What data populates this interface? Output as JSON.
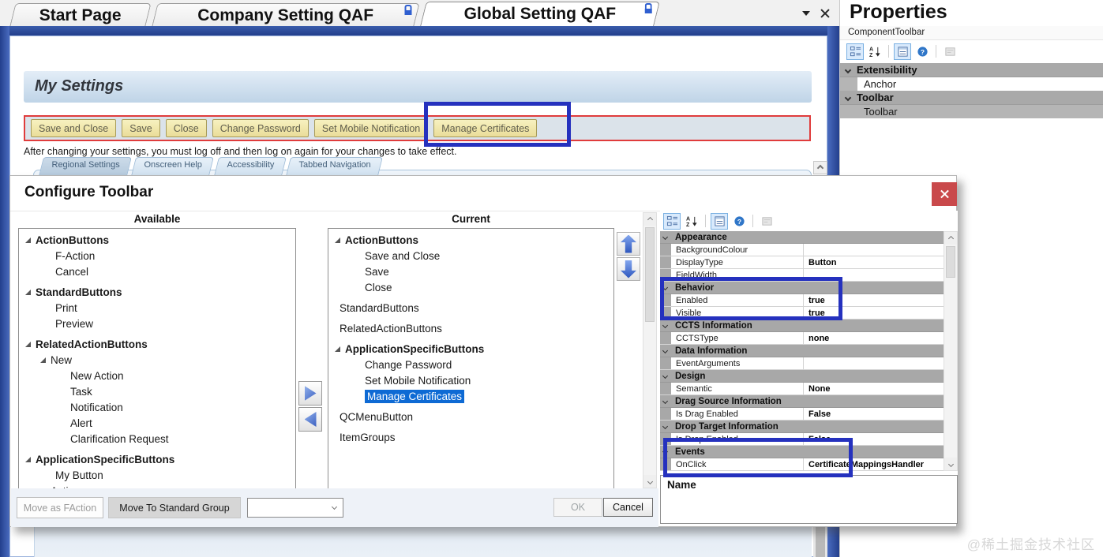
{
  "tabs": {
    "items": [
      {
        "label": "Start Page",
        "locked": false,
        "active": false
      },
      {
        "label": "Company Setting QAF",
        "locked": true,
        "active": false
      },
      {
        "label": "Global Setting QAF",
        "locked": true,
        "active": true
      }
    ]
  },
  "page": {
    "title": "My Settings",
    "toolbar_buttons": [
      "Save and Close",
      "Save",
      "Close",
      "Change Password",
      "Set Mobile Notification",
      "Manage Certificates"
    ],
    "info_text": "After changing your settings, you must log off and then log on again for your changes to take effect.",
    "sub_tabs": [
      "Regional Settings",
      "Onscreen Help",
      "Accessibility",
      "Tabbed Navigation"
    ]
  },
  "properties_panel": {
    "title": "Properties",
    "object": "ComponentToolbar",
    "rows": [
      {
        "type": "header",
        "label": "Extensibility"
      },
      {
        "type": "item",
        "label": "Anchor"
      },
      {
        "type": "header",
        "label": "Toolbar"
      },
      {
        "type": "item",
        "label": "Toolbar",
        "gray": true
      }
    ]
  },
  "dialog": {
    "title": "Configure Toolbar",
    "available": {
      "header": "Available",
      "items": [
        {
          "label": "ActionButtons",
          "pad": 8,
          "tri": true,
          "bold": true
        },
        {
          "label": "F-Action",
          "pad": 46
        },
        {
          "label": "Cancel",
          "pad": 46
        },
        {
          "label": "StandardButtons",
          "pad": 8,
          "tri": true,
          "bold": true,
          "gap": true
        },
        {
          "label": "Print",
          "pad": 46
        },
        {
          "label": "Preview",
          "pad": 46
        },
        {
          "label": "RelatedActionButtons",
          "pad": 8,
          "tri": true,
          "bold": true,
          "gap": true
        },
        {
          "label": "New",
          "pad": 27,
          "tri": true
        },
        {
          "label": "New Action",
          "pad": 65
        },
        {
          "label": "Task",
          "pad": 65
        },
        {
          "label": "Notification",
          "pad": 65
        },
        {
          "label": "Alert",
          "pad": 65
        },
        {
          "label": "Clarification Request",
          "pad": 65
        },
        {
          "label": "ApplicationSpecificButtons",
          "pad": 8,
          "tri": true,
          "bold": true,
          "gap": true
        },
        {
          "label": "My Button",
          "pad": 46
        },
        {
          "label": "Actions",
          "pad": 27,
          "tri": true
        }
      ]
    },
    "current": {
      "header": "Current",
      "items": [
        {
          "label": "ActionButtons",
          "pad": 8,
          "tri": true,
          "bold": true
        },
        {
          "label": "Save and Close",
          "pad": 46
        },
        {
          "label": "Save",
          "pad": 46
        },
        {
          "label": "Close",
          "pad": 46
        },
        {
          "label": "StandardButtons",
          "pad": 14,
          "gap": true
        },
        {
          "label": "RelatedActionButtons",
          "pad": 14,
          "gap": true
        },
        {
          "label": "ApplicationSpecificButtons",
          "pad": 8,
          "tri": true,
          "bold": true,
          "gap": true
        },
        {
          "label": "Change Password",
          "pad": 46
        },
        {
          "label": "Set Mobile Notification",
          "pad": 46
        },
        {
          "label": "Manage Certificates",
          "pad": 46,
          "sel": true
        },
        {
          "label": "QCMenuButton",
          "pad": 14,
          "gap": true
        },
        {
          "label": "ItemGroups",
          "pad": 14,
          "gap": true
        }
      ]
    },
    "grid_rows": [
      {
        "type": "header",
        "label": "Appearance"
      },
      {
        "type": "prop",
        "name": "BackgroundColour",
        "value": ""
      },
      {
        "type": "prop",
        "name": "DisplayType",
        "value": "Button"
      },
      {
        "type": "prop",
        "name": "FieldWidth",
        "value": ""
      },
      {
        "type": "header",
        "label": "Behavior"
      },
      {
        "type": "prop",
        "name": "Enabled",
        "value": "true"
      },
      {
        "type": "prop",
        "name": "Visible",
        "value": "true"
      },
      {
        "type": "header",
        "label": "CCTS Information"
      },
      {
        "type": "prop",
        "name": "CCTSType",
        "value": "none"
      },
      {
        "type": "header",
        "label": "Data Information"
      },
      {
        "type": "prop",
        "name": "EventArguments",
        "value": ""
      },
      {
        "type": "header",
        "label": "Design"
      },
      {
        "type": "prop",
        "name": "Semantic",
        "value": "None"
      },
      {
        "type": "header",
        "label": "Drag Source Information"
      },
      {
        "type": "prop",
        "name": "Is Drag Enabled",
        "value": "False"
      },
      {
        "type": "header",
        "label": "Drop Target Information"
      },
      {
        "type": "prop",
        "name": "Is Drop Enabled",
        "value": "False"
      },
      {
        "type": "header",
        "label": "Events"
      },
      {
        "type": "prop",
        "name": "OnClick",
        "value": "CertificateMappingsHandler"
      }
    ],
    "description_title": "Name",
    "footer": {
      "move_as_faction": "Move as FAction",
      "move_to_standard_group": "Move To Standard Group",
      "ok": "OK",
      "cancel": "Cancel"
    }
  },
  "watermark": "@稀土掘金技术社区",
  "colors": {
    "annotation_blue": "#2531be",
    "annotation_red": "#e03c3c",
    "selection_blue": "#0e6ad4",
    "close_red": "#c9494b",
    "frame_navy": "#233f8c",
    "button_tan": "#f0e7ad",
    "category_gray": "#a8a8a8"
  }
}
